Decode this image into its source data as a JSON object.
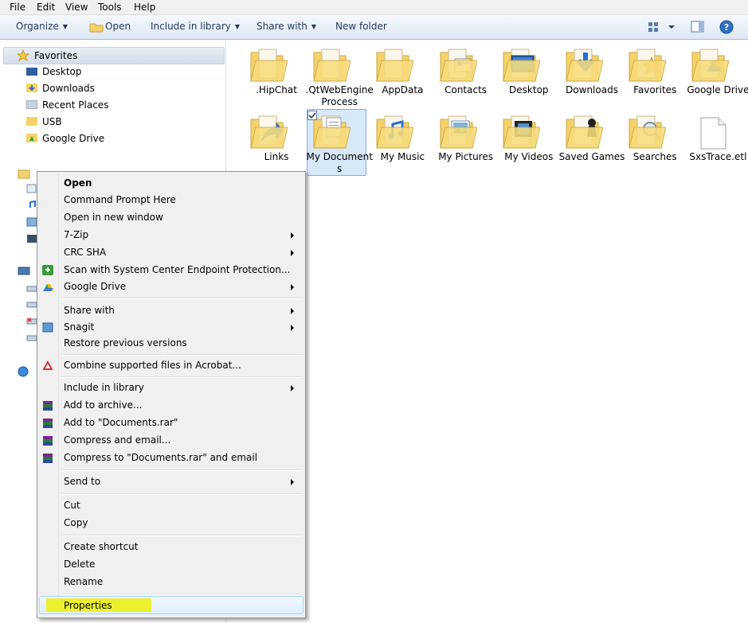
{
  "menubar": {
    "file": "File",
    "edit": "Edit",
    "view": "View",
    "tools": "Tools",
    "help": "Help"
  },
  "toolbar": {
    "organize": "Organize",
    "open": "Open",
    "include": "Include in library",
    "share": "Share with",
    "new_folder": "New folder"
  },
  "nav": {
    "favorites": "Favorites",
    "items": [
      "Desktop",
      "Downloads",
      "Recent Places",
      "USB",
      "Google Drive"
    ]
  },
  "files": [
    {
      "label": ".HipChat"
    },
    {
      "label": ".QtWebEngineProcess"
    },
    {
      "label": "AppData"
    },
    {
      "label": "Contacts"
    },
    {
      "label": "Desktop"
    },
    {
      "label": "Downloads"
    },
    {
      "label": "Favorites"
    },
    {
      "label": "Google Drive"
    },
    {
      "label": "Links"
    },
    {
      "label": "My Documents"
    },
    {
      "label": "My Music"
    },
    {
      "label": "My Pictures"
    },
    {
      "label": "My Videos"
    },
    {
      "label": "Saved Games"
    },
    {
      "label": "Searches"
    },
    {
      "label": "SxsTrace.etl"
    }
  ],
  "context_menu": {
    "items": [
      "Open",
      "Command Prompt Here",
      "Open in new window",
      "7-Zip",
      "CRC SHA",
      "Scan with System Center Endpoint Protection...",
      "Google Drive",
      "Share with",
      "Snagit",
      "Restore previous versions",
      "Combine supported files in Acrobat...",
      "Include in library",
      "Add to archive...",
      "Add to \"Documents.rar\"",
      "Compress and email...",
      "Compress to \"Documents.rar\" and email",
      "Send to",
      "Cut",
      "Copy",
      "Create shortcut",
      "Delete",
      "Rename",
      "Properties"
    ],
    "highlight_color": "#ecf02f"
  },
  "colors": {
    "folder": "#f5d36a",
    "accent": "#1e395b",
    "selection": "#d7e8f9"
  }
}
